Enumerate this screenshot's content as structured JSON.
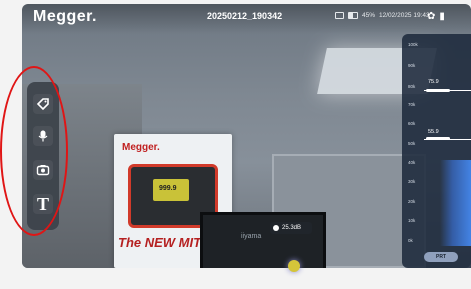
{
  "app": {
    "logo": "Megger.",
    "file_title": "20250212_190342"
  },
  "status": {
    "battery": "45%",
    "datetime": "12/02/2025 19:43"
  },
  "toolbar": {
    "tools": [
      {
        "icon": "tag-icon"
      },
      {
        "icon": "microphone-icon"
      },
      {
        "icon": "camera-icon"
      },
      {
        "icon": "text-icon",
        "glyph": "T"
      }
    ]
  },
  "level_panel": {
    "scale": [
      "100k",
      "90k",
      "80k",
      "70k",
      "60k",
      "50k",
      "40k",
      "30k",
      "20k",
      "10k",
      "0k"
    ],
    "upper_value": "75.9",
    "lower_value": "55.9",
    "button_label": "PRT"
  },
  "readout": {
    "value": "25.3dB"
  },
  "scene": {
    "banner_logo": "Megger.",
    "banner_text": "The NEW MIT",
    "lcd_value": "999.9",
    "monitor_label": "iiyama"
  },
  "colors": {
    "annotation": "#e01515",
    "panel_bg": "#1e2a3c",
    "accent_red": "#c02020"
  }
}
